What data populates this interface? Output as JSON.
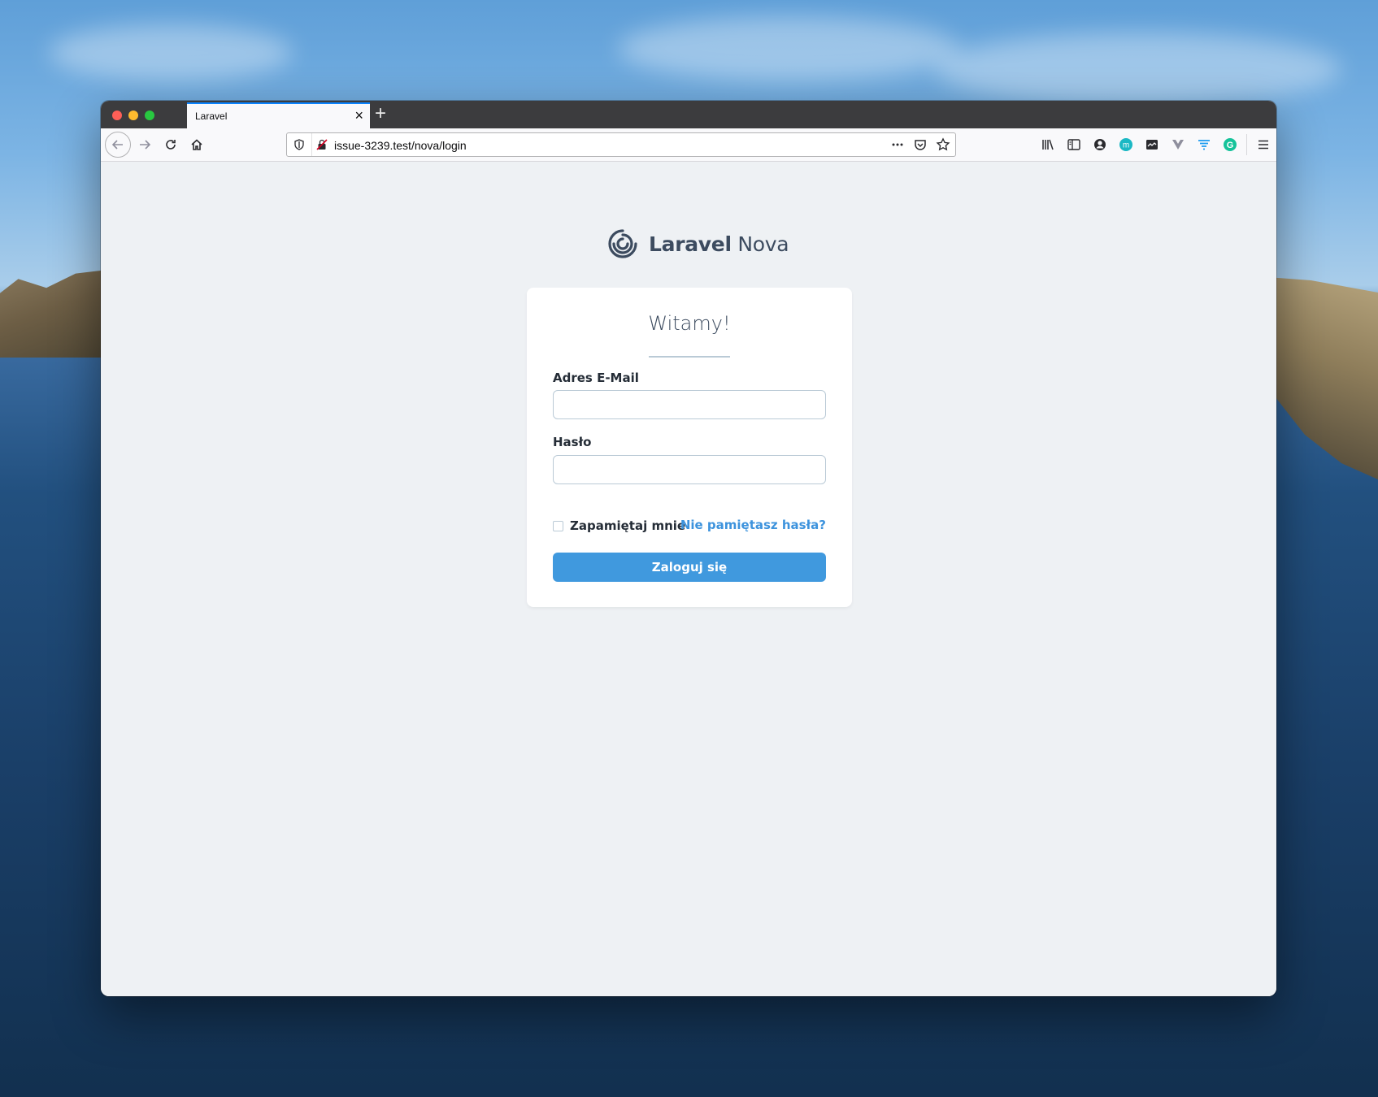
{
  "browser": {
    "tab_title": "Laravel",
    "url": "issue-3239.test/nova/login"
  },
  "brand": {
    "name_strong": "Laravel",
    "name_light": " Nova"
  },
  "login": {
    "heading": "Witamy!",
    "email_label": "Adres E-Mail",
    "email_value": "",
    "password_label": "Hasło",
    "password_value": "",
    "remember_label": "Zapamiętaj mnie",
    "remember_checked": false,
    "forgot_link": "Nie pamiętasz hasła?",
    "submit_label": "Zaloguj się"
  },
  "colors": {
    "primary": "#4099de",
    "link": "#3d93dd",
    "background": "#eef1f4",
    "heading_text": "#3c4b5f"
  }
}
